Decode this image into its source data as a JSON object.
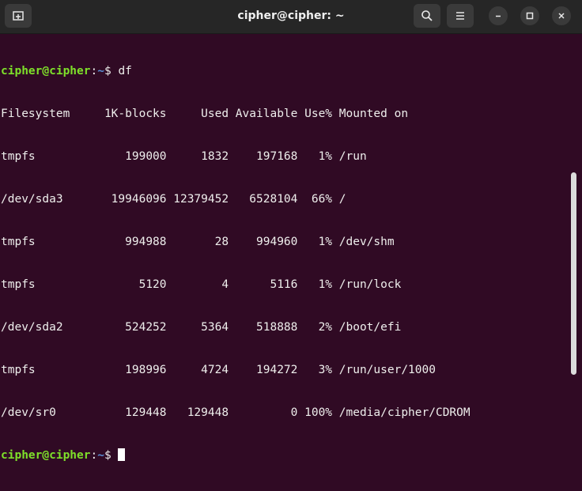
{
  "window": {
    "title": "cipher@cipher: ~"
  },
  "icons": {
    "new_tab": "new-tab-icon",
    "search": "search-icon",
    "menu": "hamburger-menu-icon",
    "minimize": "minimize-icon",
    "maximize": "maximize-icon",
    "close": "close-icon"
  },
  "prompt": {
    "user": "cipher@cipher",
    "sep": ":",
    "path": "~",
    "symbol": "$ "
  },
  "command": "df",
  "output_lines": [
    "Filesystem     1K-blocks     Used Available Use% Mounted on",
    "tmpfs             199000     1832    197168   1% /run",
    "/dev/sda3       19946096 12379452   6528104  66% /",
    "tmpfs             994988       28    994960   1% /dev/shm",
    "tmpfs               5120        4      5116   1% /run/lock",
    "/dev/sda2         524252     5364    518888   2% /boot/efi",
    "tmpfs             198996     4724    194272   3% /run/user/1000",
    "/dev/sr0          129448   129448         0 100% /media/cipher/CDROM"
  ],
  "colors": {
    "background": "#300a24",
    "prompt_user": "#7ee02a",
    "prompt_path": "#5a8fd6",
    "text": "#eeeeec",
    "titlebar": "#262626"
  }
}
